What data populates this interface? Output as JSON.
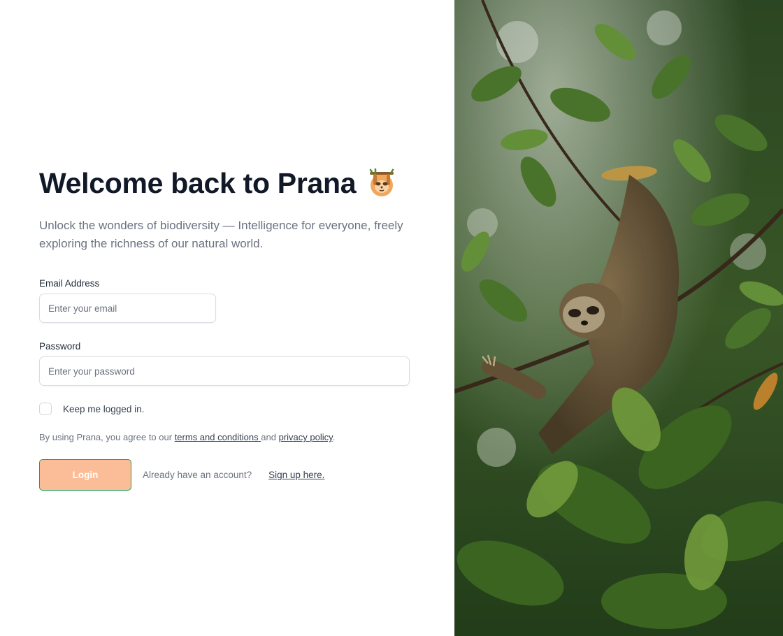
{
  "login": {
    "title": "Welcome back to Prana",
    "title_icon": "sloth-icon",
    "subtitle": "Unlock the wonders of biodiversity — Intelligence for everyone, freely exploring the richness of our natural world.",
    "email_label": "Email Address",
    "email_placeholder": "Enter your email",
    "email_value": "",
    "password_label": "Password",
    "password_placeholder": "Enter your password",
    "password_value": "",
    "remember_label": "Keep me logged in.",
    "remember_checked": false,
    "terms_prefix": "By using Prana, you agree to our ",
    "terms_link": "terms and conditions ",
    "terms_and": "and ",
    "privacy_link": "privacy policy",
    "terms_suffix": ".",
    "login_button": "Login",
    "signup_prompt": "Already have an account?",
    "signup_link": "Sign up here."
  },
  "hero_image": {
    "subject": "sloth-in-tree-photo"
  },
  "colors": {
    "login_button_bg": "#fbbd97",
    "login_button_border": "#22a05a",
    "title": "#111827",
    "muted_text": "#6b7280"
  }
}
